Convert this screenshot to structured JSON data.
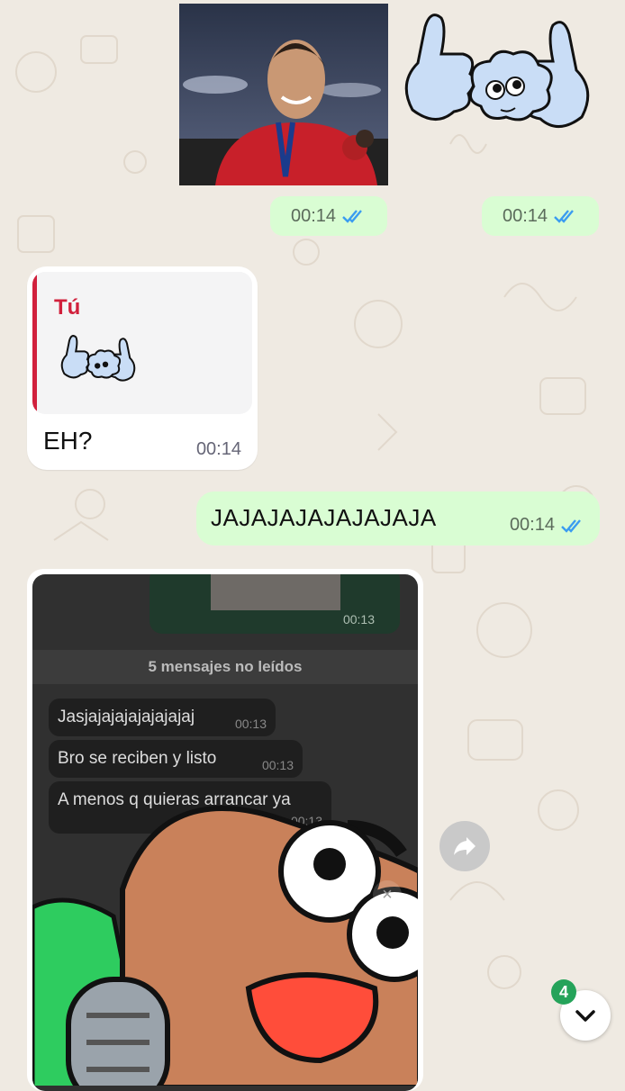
{
  "messages": {
    "photo_time": "00:14",
    "photo_status": "double-check-icon",
    "sticker_time": "00:14",
    "sticker_status": "double-check-icon",
    "reply": {
      "quoted_author": "Tú",
      "text": "EH?",
      "time": "00:14"
    },
    "sent_text": {
      "text": "JAJAJAJAJAJAJAJA",
      "time": "00:14",
      "status": "double-check-icon"
    }
  },
  "screenshot_message": {
    "sent_time": "00:13",
    "unread_label": "5 mensajes no leídos",
    "bubbles": [
      {
        "text": "Jasjajajajajajajajaj",
        "time": "00:13"
      },
      {
        "text": "Bro se reciben y listo",
        "time": "00:13"
      },
      {
        "text": "A menos q quieras arrancar ya",
        "time": "00:13"
      }
    ],
    "close_symbol": "×"
  },
  "controls": {
    "forward_icon": "forward-arrow-icon",
    "scroll_down_icon": "chevron-down-icon",
    "unread_count": "4"
  },
  "colors": {
    "sent_bubble": "#d9fdd3",
    "received_bubble": "#ffffff",
    "accent_red": "#d1203c",
    "read_ticks": "#3b9cf0",
    "badge": "#25a35a"
  }
}
